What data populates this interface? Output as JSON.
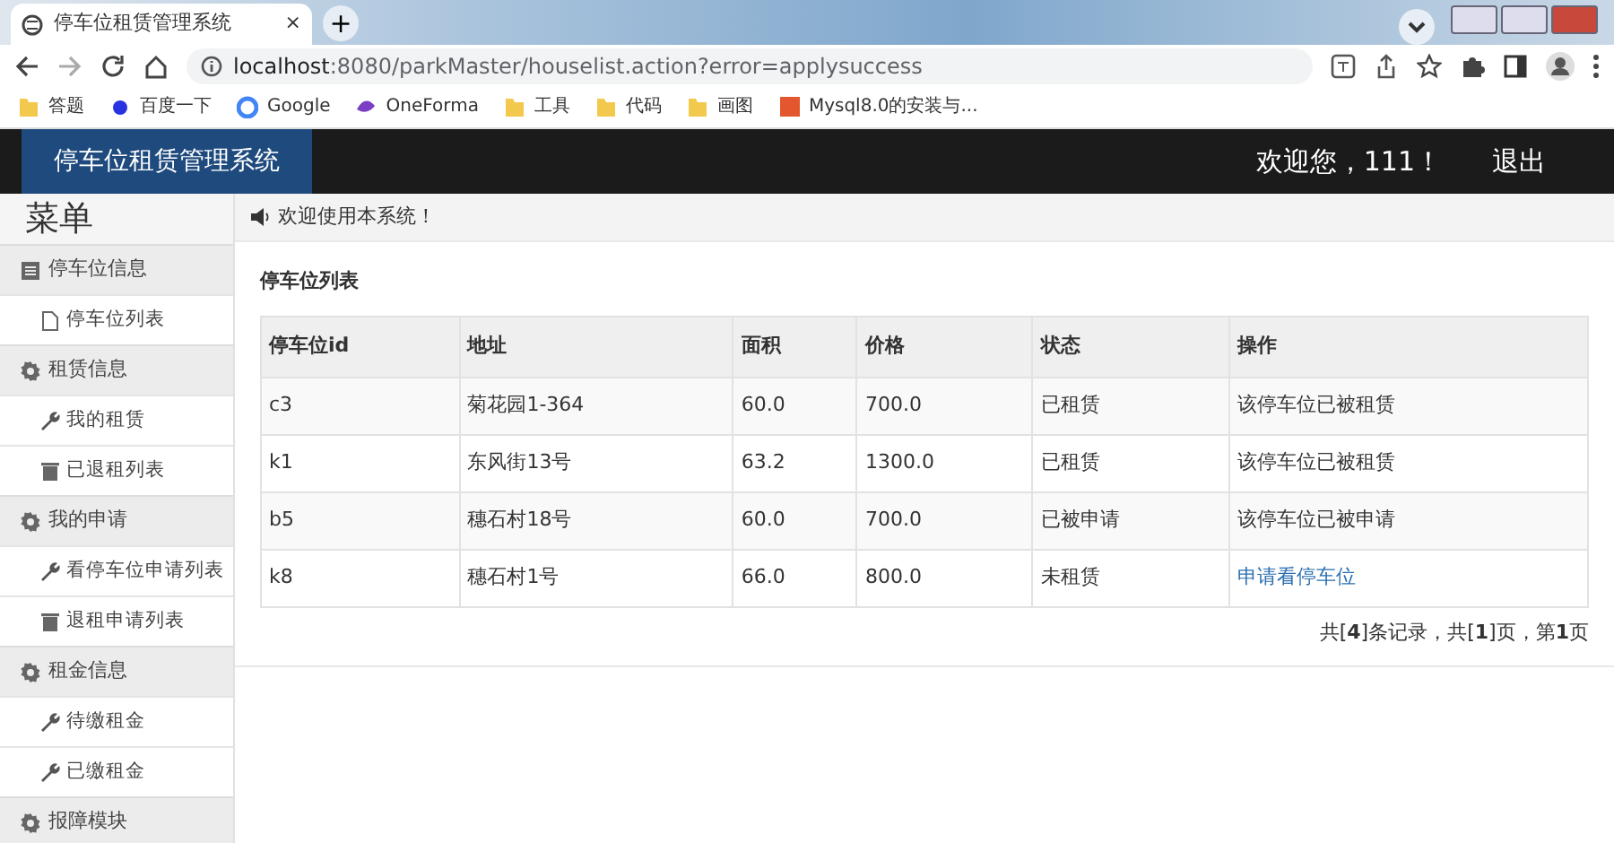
{
  "browser": {
    "tab_title": "停车位租赁管理系统",
    "tab_close": "×",
    "new_tab": "+",
    "url_host": "localhost",
    "url_rest": ":8080/parkMaster/houselist.action?error=applysuccess",
    "bookmarks": [
      "答题",
      "百度一下",
      "Google",
      "OneForma",
      "工具",
      "代码",
      "画图",
      "Mysql8.0的安装与..."
    ]
  },
  "header": {
    "brand": "停车位租赁管理系统",
    "welcome": "欢迎您，111！",
    "logout": "退出"
  },
  "sidebar": {
    "title": "菜单",
    "groups": [
      {
        "label": "停车位信息",
        "children": [
          {
            "label": "停车位列表"
          }
        ]
      },
      {
        "label": "租赁信息",
        "children": [
          {
            "label": "我的租赁"
          },
          {
            "label": "已退租列表"
          }
        ]
      },
      {
        "label": "我的申请",
        "children": [
          {
            "label": "看停车位申请列表"
          },
          {
            "label": "退租申请列表"
          }
        ]
      },
      {
        "label": "租金信息",
        "children": [
          {
            "label": "待缴租金"
          },
          {
            "label": "已缴租金"
          }
        ]
      },
      {
        "label": "报障模块"
      }
    ]
  },
  "notice": "欢迎使用本系统！",
  "panel_title": "停车位列表",
  "table": {
    "columns": [
      "停车位id",
      "地址",
      "面积",
      "价格",
      "状态",
      "操作"
    ],
    "rows": [
      {
        "cells": [
          "c3",
          "菊花园1-364",
          "60.0",
          "700.0",
          "已租赁"
        ],
        "action": {
          "kind": "text",
          "text": "该停车位已被租赁"
        }
      },
      {
        "cells": [
          "k1",
          "东风街13号",
          "63.2",
          "1300.0",
          "已租赁"
        ],
        "action": {
          "kind": "text",
          "text": "该停车位已被租赁"
        }
      },
      {
        "cells": [
          "b5",
          "穗石村18号",
          "60.0",
          "700.0",
          "已被申请"
        ],
        "action": {
          "kind": "text",
          "text": "该停车位已被申请"
        }
      },
      {
        "cells": [
          "k8",
          "穗石村1号",
          "66.0",
          "800.0",
          "未租赁"
        ],
        "action": {
          "kind": "link",
          "text": "申请看停车位"
        }
      }
    ]
  },
  "pagination": "共[**4**]条记录，共[**1**]页，第**1**页"
}
